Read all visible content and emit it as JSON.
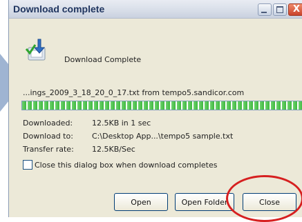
{
  "window": {
    "title": "Download complete",
    "close_glyph": "X"
  },
  "dialog": {
    "header_text": "Download Complete",
    "file_line": "...ings_2009_3_18_20_0_17.txt from tempo5.sandicor.com",
    "progress_percent": 100,
    "info": [
      {
        "label": "Downloaded:",
        "value": "12.5KB in 1 sec"
      },
      {
        "label": "Download to:",
        "value": "C:\\Desktop App...\\tempo5 sample.txt"
      },
      {
        "label": "Transfer rate:",
        "value": "12.5KB/Sec"
      }
    ],
    "checkbox_label": "Close this dialog box when download completes",
    "checkbox_checked": false
  },
  "buttons": {
    "open": "Open",
    "open_folder": "Open Folder",
    "close": "Close"
  },
  "colors": {
    "highlight": "#d62020",
    "progress": "#3fb83f"
  },
  "icons": [
    "download-complete-icon",
    "minimize-icon",
    "maximize-icon",
    "close-icon"
  ]
}
